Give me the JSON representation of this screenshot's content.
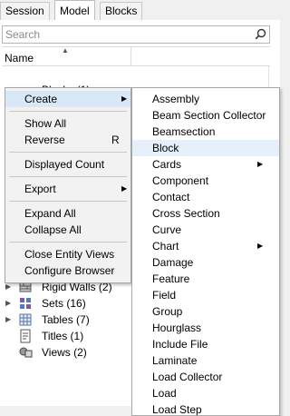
{
  "tabs": [
    {
      "label": "Session",
      "active": false
    },
    {
      "label": "Model",
      "active": true
    },
    {
      "label": "Blocks",
      "active": false
    }
  ],
  "close_glyph": "✕",
  "search": {
    "placeholder": "Search"
  },
  "columns": {
    "name": "Name"
  },
  "partially_visible_row": {
    "label": "Blocks (1)"
  },
  "tree_rows": [
    {
      "label": "Rigid Walls  (2)",
      "icon": "rigid-wall-icon",
      "expandable": true
    },
    {
      "label": "Sets  (16)",
      "icon": "sets-icon",
      "expandable": true
    },
    {
      "label": "Tables  (7)",
      "icon": "table-icon",
      "expandable": true
    },
    {
      "label": "Titles  (1)",
      "icon": "title-icon",
      "expandable": false
    },
    {
      "label": "Views  (2)",
      "icon": "views-icon",
      "expandable": false
    }
  ],
  "context_menu": {
    "items": [
      {
        "label": "Create",
        "submenu": true,
        "highlighted": true
      },
      {
        "label": "Show All"
      },
      {
        "label": "Reverse",
        "shortcut": "R"
      },
      {
        "label": "Displayed Count"
      },
      {
        "label": "Export",
        "submenu": true
      },
      {
        "label": "Expand All"
      },
      {
        "label": "Collapse All"
      },
      {
        "label": "Close Entity Views"
      },
      {
        "label": "Configure Browser"
      }
    ]
  },
  "submenu": {
    "items": [
      {
        "label": "Assembly"
      },
      {
        "label": "Beam Section Collector"
      },
      {
        "label": "Beamsection"
      },
      {
        "label": "Block",
        "highlighted": true
      },
      {
        "label": "Cards",
        "submenu": true
      },
      {
        "label": "Component"
      },
      {
        "label": "Contact"
      },
      {
        "label": "Cross Section"
      },
      {
        "label": "Curve"
      },
      {
        "label": "Chart",
        "submenu": true
      },
      {
        "label": "Damage"
      },
      {
        "label": "Feature"
      },
      {
        "label": "Field"
      },
      {
        "label": "Group"
      },
      {
        "label": "Hourglass"
      },
      {
        "label": "Include File"
      },
      {
        "label": "Laminate"
      },
      {
        "label": "Load Collector"
      },
      {
        "label": "Load"
      },
      {
        "label": "Load Step"
      }
    ]
  },
  "colors": {
    "highlight": "#d9e8f7",
    "submenu_highlight": "#e5f0fb",
    "menu_bg": "#f2f2f2"
  }
}
